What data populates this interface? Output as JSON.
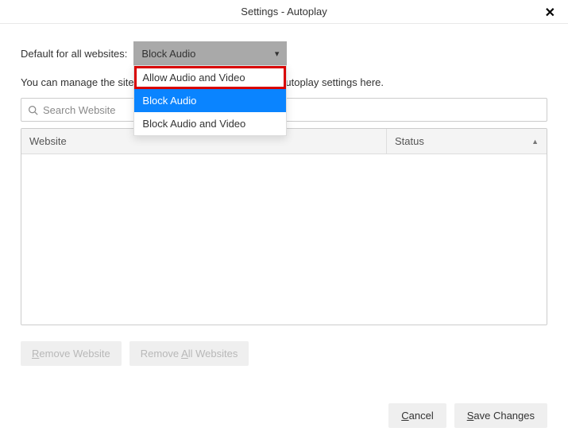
{
  "titlebar": {
    "title": "Settings - Autoplay"
  },
  "form": {
    "default_label": "Default for all websites:",
    "selected_value": "Block Audio",
    "options": {
      "opt0": "Allow Audio and Video",
      "opt1": "Block Audio",
      "opt2": "Block Audio and Video"
    },
    "description": "You can manage the sites that do not follow your default autoplay settings here."
  },
  "search": {
    "placeholder": "Search Website"
  },
  "table": {
    "col_website": "Website",
    "col_status": "Status"
  },
  "buttons": {
    "remove_website_pre": "R",
    "remove_website_rest": "emove Website",
    "remove_all_pre": "Remove ",
    "remove_all_u": "A",
    "remove_all_rest": "ll Websites",
    "cancel_u": "C",
    "cancel_rest": "ancel",
    "save_u": "S",
    "save_rest": "ave Changes"
  }
}
